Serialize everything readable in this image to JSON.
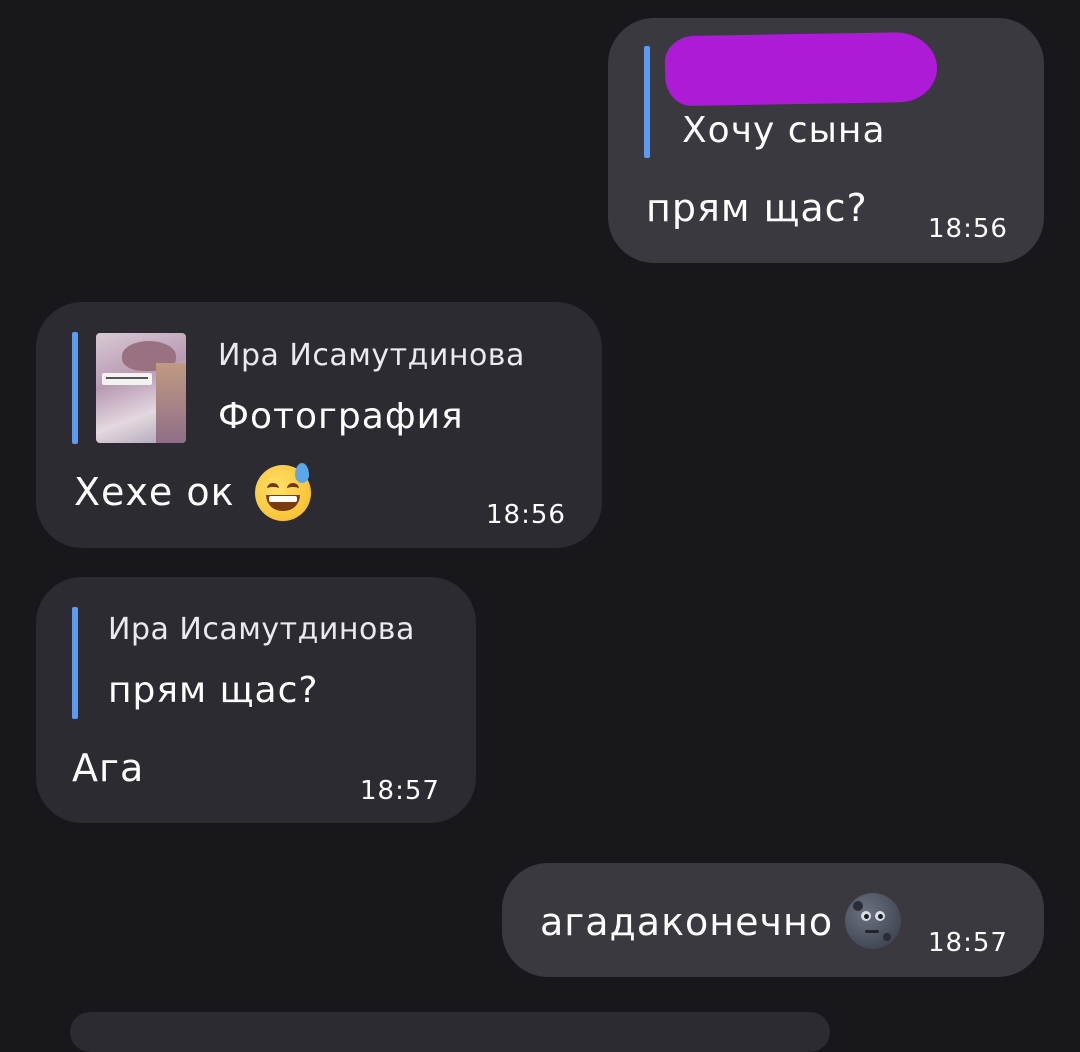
{
  "messages": [
    {
      "direction": "outgoing",
      "reply": {
        "name_redacted": true,
        "text": "Хочу сына"
      },
      "text": "прям щас?",
      "time": "18:56"
    },
    {
      "direction": "incoming",
      "reply": {
        "name": "Ира Исамутдинова",
        "text": "Фотография",
        "has_thumbnail": true
      },
      "text": "Хехе ок",
      "emoji": "grinning-face-with-sweat",
      "time": "18:56"
    },
    {
      "direction": "incoming",
      "reply": {
        "name": "Ира Исамутдинова",
        "text": "прям щас?"
      },
      "text": "Ага",
      "time": "18:57"
    },
    {
      "direction": "outgoing",
      "text": "агадаконечно",
      "emoji": "new-moon-face",
      "time": "18:57"
    }
  ],
  "colors": {
    "background": "#18171c",
    "incoming_bubble": "#2c2b31",
    "outgoing_bubble": "#3a393f",
    "reply_bar": "#5d9bf2",
    "redaction": "#ad1bd6"
  }
}
